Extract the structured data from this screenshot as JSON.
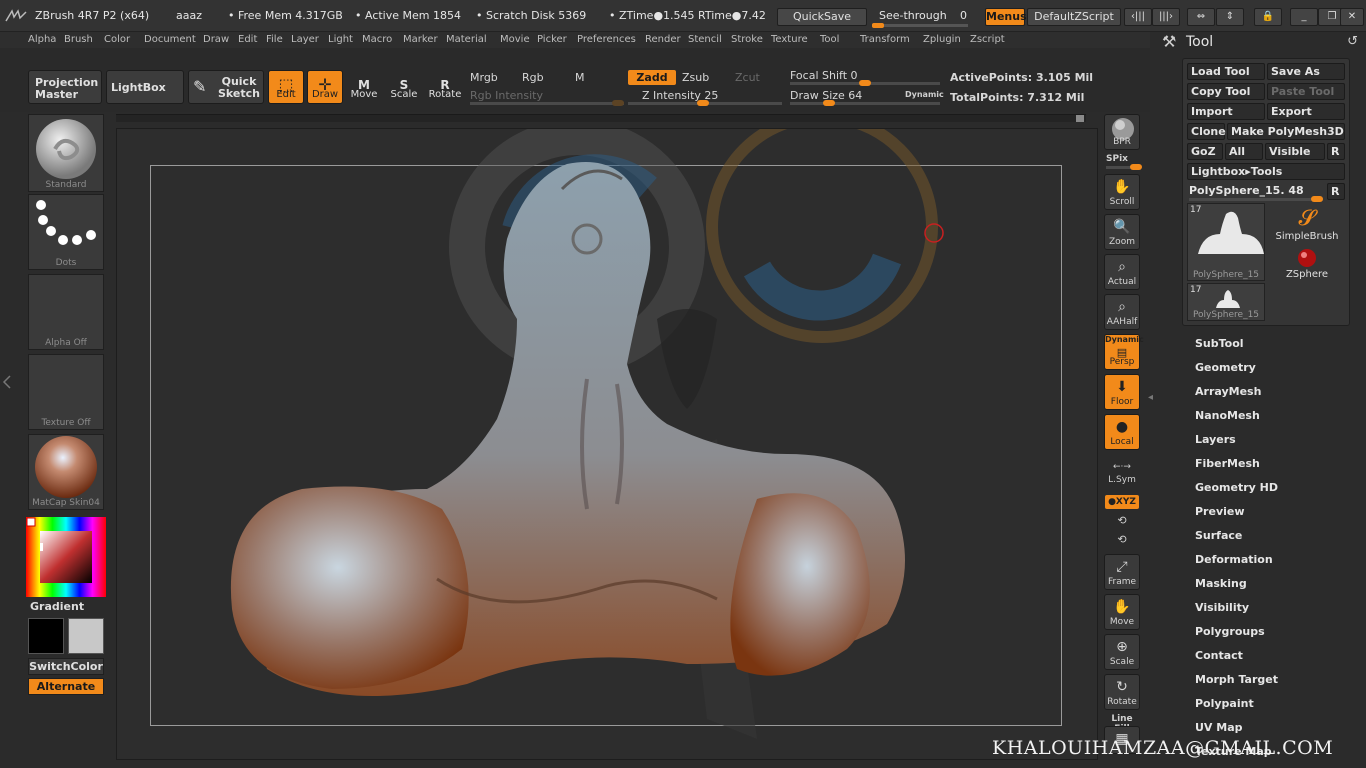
{
  "titlebar": {
    "app_name": "ZBrush 4R7 P2 (x64)",
    "doc_name": "aaaz",
    "free_mem": "• Free Mem 4.317GB",
    "active_mem": "• Active Mem 1854",
    "scratch_disk": "• Scratch Disk 5369",
    "ztime": "• ZTime●1.545 RTime●7.42",
    "quicksave": "QuickSave",
    "see_through": "See-through",
    "see_through_value": "0",
    "see_through_level": 0.0,
    "menus": "Menus",
    "default_zscript": "DefaultZScript"
  },
  "menubar": [
    "Alpha",
    "Brush",
    "Color",
    "Document",
    "Draw",
    "Edit",
    "File",
    "Layer",
    "Light",
    "Macro",
    "Marker",
    "Material",
    "Movie",
    "Picker",
    "Preferences",
    "Render",
    "Stencil",
    "Stroke",
    "Texture",
    "Tool",
    "Transform",
    "Zplugin",
    "Zscript"
  ],
  "shelf": {
    "projection_master": "Projection Master",
    "lightbox": "LightBox",
    "quick_sketch": "Quick Sketch",
    "edit": "Edit",
    "draw": "Draw",
    "move": "Move",
    "scale": "Scale",
    "rotate": "Rotate",
    "mrgb": "Mrgb",
    "rgb": "Rgb",
    "m": "M",
    "rgb_intensity": "Rgb Intensity",
    "zadd": "Zadd",
    "zsub": "Zsub",
    "zcut": "Zcut",
    "z_intensity": "Z Intensity 25",
    "z_intensity_level": 0.25,
    "focal_shift": "Focal Shift 0",
    "draw_size": "Draw Size 64",
    "dynamic": "Dynamic",
    "active_points": "ActivePoints: 3.105 Mil",
    "total_points": "TotalPoints: 7.312 Mil"
  },
  "left": {
    "brush": "Standard",
    "stroke": "Dots",
    "alpha": "Alpha Off",
    "texture": "Texture Off",
    "material": "MatCap Skin04",
    "gradient": "Gradient",
    "switchcolor": "SwitchColor",
    "alternate": "Alternate",
    "main_color": "#000000",
    "secondary_color": "#c8c8c8"
  },
  "rshelf": {
    "bpr": "BPR",
    "spix": "SPix",
    "scroll": "Scroll",
    "zoom": "Zoom",
    "actual": "Actual",
    "aahalf": "AAHalf",
    "dynamic": "Dynamic",
    "persp": "Persp",
    "floor": "Floor",
    "local": "Local",
    "lsym": "L.Sym",
    "xyz": "●XYZ",
    "frame": "Frame",
    "move": "Move",
    "scale": "Scale",
    "rotate": "Rotate",
    "linefill": "Line Fill"
  },
  "tool": {
    "title": "Tool",
    "load_tool": "Load Tool",
    "save_as": "Save As",
    "copy_tool": "Copy Tool",
    "paste_tool": "Paste Tool",
    "import": "Import",
    "export": "Export",
    "clone": "Clone",
    "make_polymesh": "Make PolyMesh3D",
    "goz": "GoZ",
    "all": "All",
    "visible": "Visible",
    "r": "R",
    "lightbox_tools": "Lightbox▸Tools",
    "current_tool": "PolySphere_15. 48",
    "thumb1_num": "17",
    "thumb1_cap": "PolySphere_15",
    "thumb2_num": "17",
    "thumb2_cap": "PolySphere_15",
    "simplebrush": "SimpleBrush",
    "zsphere": "ZSphere",
    "subpalettes": [
      "SubTool",
      "Geometry",
      "ArrayMesh",
      "NanoMesh",
      "Layers",
      "FiberMesh",
      "Geometry HD",
      "Preview",
      "Surface",
      "Deformation",
      "Masking",
      "Visibility",
      "Polygroups",
      "Contact",
      "Morph Target",
      "Polypaint",
      "UV Map",
      "Texture Map"
    ]
  },
  "watermark": "KHALOUIHAMZAA@GMAIL.COM",
  "colors": {
    "accent": "#f28a1a",
    "panel": "#2b2b2b",
    "button": "#3a3a3a"
  }
}
